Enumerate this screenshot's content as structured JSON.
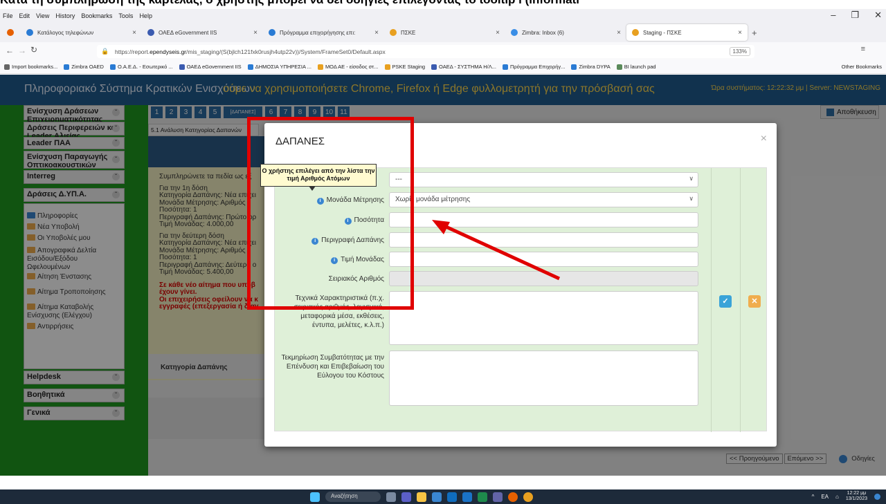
{
  "caption": "Κατά τη συμπλήρωση της καρτέλας, ο χρήστης μπορεί να δει οδηγίες επιλέγοντας το tooltip i (informati",
  "browser": {
    "menu": [
      "File",
      "Edit",
      "View",
      "History",
      "Bookmarks",
      "Tools",
      "Help"
    ],
    "tabs": [
      {
        "label": "Κατάλογος τηλεφώνων",
        "color": "#2a7bd4"
      },
      {
        "label": "ΟΑΕΔ eGovernment IIS",
        "color": "#3b5bb0"
      },
      {
        "label": "Πρόγραμμα επιχορήγησης επι:",
        "color": "#2a7bd4"
      },
      {
        "label": "ΠΣΚΕ",
        "color": "#e8a020"
      },
      {
        "label": "Zimbra: Inbox (6)",
        "color": "#3a8ee6"
      },
      {
        "label": "Staging - ΠΣΚΕ",
        "color": "#e8a020"
      }
    ],
    "url_prefix": "https://report.",
    "url_domain": "ependyseis.gr",
    "url_suffix": "/mis_staging/(S(bjlch121fxk0rusjh4utp22v))/System/FrameSet0/Default.aspx",
    "zoom": "133%",
    "bookmarks": [
      "Import bookmarks...",
      "Zimbra OAED",
      "Ο.Α.Ε.Δ. - Εσωτερικό ...",
      "ΟΑΕΔ eGovernment IIS",
      "ΔΗΜΟΣΙΑ ΥΠΗΡΕΣΙΑ ...",
      "ΜΟΔ ΑΕ - είσοδος στ...",
      "PSKE Staging",
      "ΟΑΕΔ - ΣΥΣΤΗΜΑ Η/Λ...",
      "Πρόγραμμα Επιχορήγ...",
      "Zimbra DYPA",
      "BI launch pad"
    ],
    "other_bookmarks": "Other Bookmarks"
  },
  "app": {
    "title": "Πληροφοριακό Σύστημα Κρατικών Ενισχύσεων",
    "marquee": "ούμε να χρησιμοποιήσετε Chrome, Firefox ή Edge φυλλομετρητή για την πρόσβασή σας",
    "server_info": "Ώρα συστήματος: 12:22:32 μμ | Server: NEWSTAGING",
    "save_label": "Αποθήκευση",
    "steps": [
      "1",
      "2",
      "3",
      "4",
      "5",
      "[ΔΑΠΑΝΕΣ]",
      "6",
      "7",
      "8",
      "9",
      "10",
      "11"
    ],
    "subtab": "5.1 Ανάλυση Κατηγορίας Δαπανών",
    "column_header": "Κατηγορία Δαπάνης",
    "nav_prev": "<< Προηγούμενο",
    "nav_next": "Επόμενο >>",
    "nav_help": "Οδηγίες"
  },
  "sidebar": {
    "groups": [
      "Ενίσχυση Δράσεων Επιχειρηματικότητας",
      "Δράσεις Περιφερειών και Leader Αλιείας",
      "Leader ΠΑΑ",
      "Ενίσχυση Παραγωγής Οπτικοακουστικών Έργων",
      "Interreg",
      "Δράσεις Δ.ΥΠ.Α."
    ],
    "items": [
      "Πληροφορίες",
      "Νέα Υποβολή",
      "Οι Υποβολές μου",
      "Απογραφικά Δελτία Εισόδου/Εξόδου Ωφελουμένων",
      "Αίτηση Ένστασης",
      "Αίτημα Τροποποίησης",
      "Αίτημα Καταβολής Ενίσχυσης (Ελέγχου)",
      "Αντιρρήσεις"
    ],
    "groups2": [
      "Helpdesk",
      "Βοηθητικά",
      "Γενικά"
    ]
  },
  "instructions": [
    {
      "t": "Συμπληρώνετε τα πεδία ως εξ",
      "red": false
    },
    {
      "t": "Για την 1η δόση",
      "red": false
    },
    {
      "t": "Κατηγορία Δαπάνης: Νέα επιχει",
      "red": false
    },
    {
      "t": "Μονάδα Μέτρησης: Αριθμός",
      "red": false
    },
    {
      "t": "Ποσότητα: 1",
      "red": false
    },
    {
      "t": "Περιγραφή Δαπάνης: Πρώτο ορ",
      "red": false
    },
    {
      "t": "Τιμή Μονάδας: 4.000,00",
      "red": false
    },
    {
      "t": "Για την δεύτερη δόση",
      "red": false
    },
    {
      "t": "Κατηγορία Δαπάνης: Νέα επιχει",
      "red": false
    },
    {
      "t": "Μονάδα Μέτρησης: Αριθμός",
      "red": false
    },
    {
      "t": "Ποσότητα: 1",
      "red": false
    },
    {
      "t": "Περιγραφή Δαπάνης: Δεύτερο ο",
      "red": false
    },
    {
      "t": "Τιμή Μονάδας: 5.400,00",
      "red": false
    },
    {
      "t": "Σε κάθε νέο αίτημα που υποβ",
      "red": true
    },
    {
      "t": "έχουν γίνει.",
      "red": true
    },
    {
      "t": "Οι επιχειρήσεις οφείλουν να κ",
      "red": true
    },
    {
      "t": "εγγραφές (επεξεργασία ή διαγ",
      "red": true
    }
  ],
  "modal": {
    "title": "ΔΑΠΑΝΕΣ",
    "close": "×",
    "category_value": "---",
    "unit_label": "Μονάδα Μέτρησης",
    "unit_value": "Χωρίς μονάδα μέτρησης",
    "quantity_label": "Ποσότητα",
    "description_label": "Περιγραφή Δαπάνης",
    "unit_price_label": "Τιμή Μονάδας",
    "serial_label": "Σειριακός Αριθμός",
    "tech_label": "Τεχνικά Χαρακτηριστικά (π.χ. σειριακός αριθμός, λογισμικό, μεταφορικά μέσα, εκθέσεις, έντυπα, μελέτες, κ.λ.π.)",
    "documentation_label": "Τεκμηρίωση Συμβατότητας με την Επένδυση και Επιβεβαίωση του Εύλογου του Κόστους"
  },
  "tooltip": "Ο χρήστης επιλέγει από την λίστα την τιμή Αριθμός Ατόμων",
  "taskbar": {
    "search": "Αναζήτηση",
    "lang": "EA",
    "time": "12:22 μμ",
    "date": "13/1/2023"
  },
  "colors": {
    "header": "#1f5b8e",
    "sidebar": "#1f9a1f",
    "highlight": "#e00000",
    "modal_body": "#dff0d8"
  }
}
